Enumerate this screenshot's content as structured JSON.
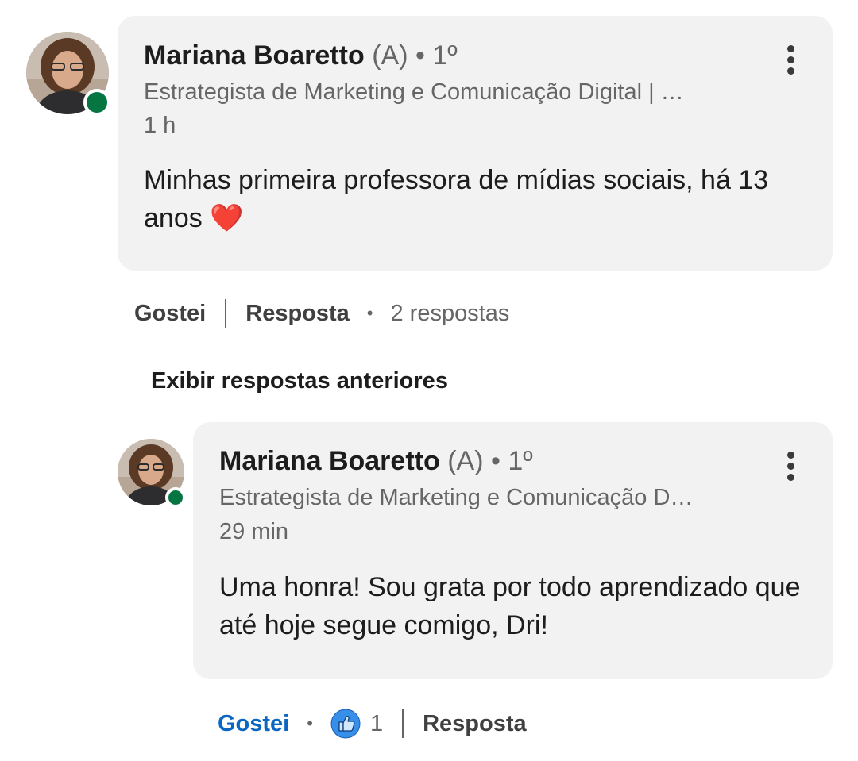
{
  "comment": {
    "author": "Mariana Boaretto",
    "pronoun": "(A)",
    "degree": "1º",
    "headline": "Estrategista de Marketing e Comunicação Digital | …",
    "time": "1 h",
    "text": "Minhas primeira professora de mídias sociais, há 13 anos ❤️",
    "actions": {
      "like": "Gostei",
      "reply": "Resposta",
      "replies_count": "2 respostas"
    }
  },
  "show_previous_replies": "Exibir respostas anteriores",
  "reply": {
    "author": "Mariana Boaretto",
    "pronoun": "(A)",
    "degree": "1º",
    "headline": "Estrategista de Marketing e Comunicação D…",
    "time": "29 min",
    "text": "Uma honra! Sou grata por todo aprendizado que até hoje segue comigo, Dri!",
    "actions": {
      "like": "Gostei",
      "reaction_count": "1",
      "reply": "Resposta"
    }
  },
  "colors": {
    "presence": "#057642",
    "like_active": "#0a66c2",
    "bubble": "#f2f2f2"
  },
  "icons": {
    "reaction": "thumbs-up-icon",
    "menu": "more-vertical-icon"
  }
}
